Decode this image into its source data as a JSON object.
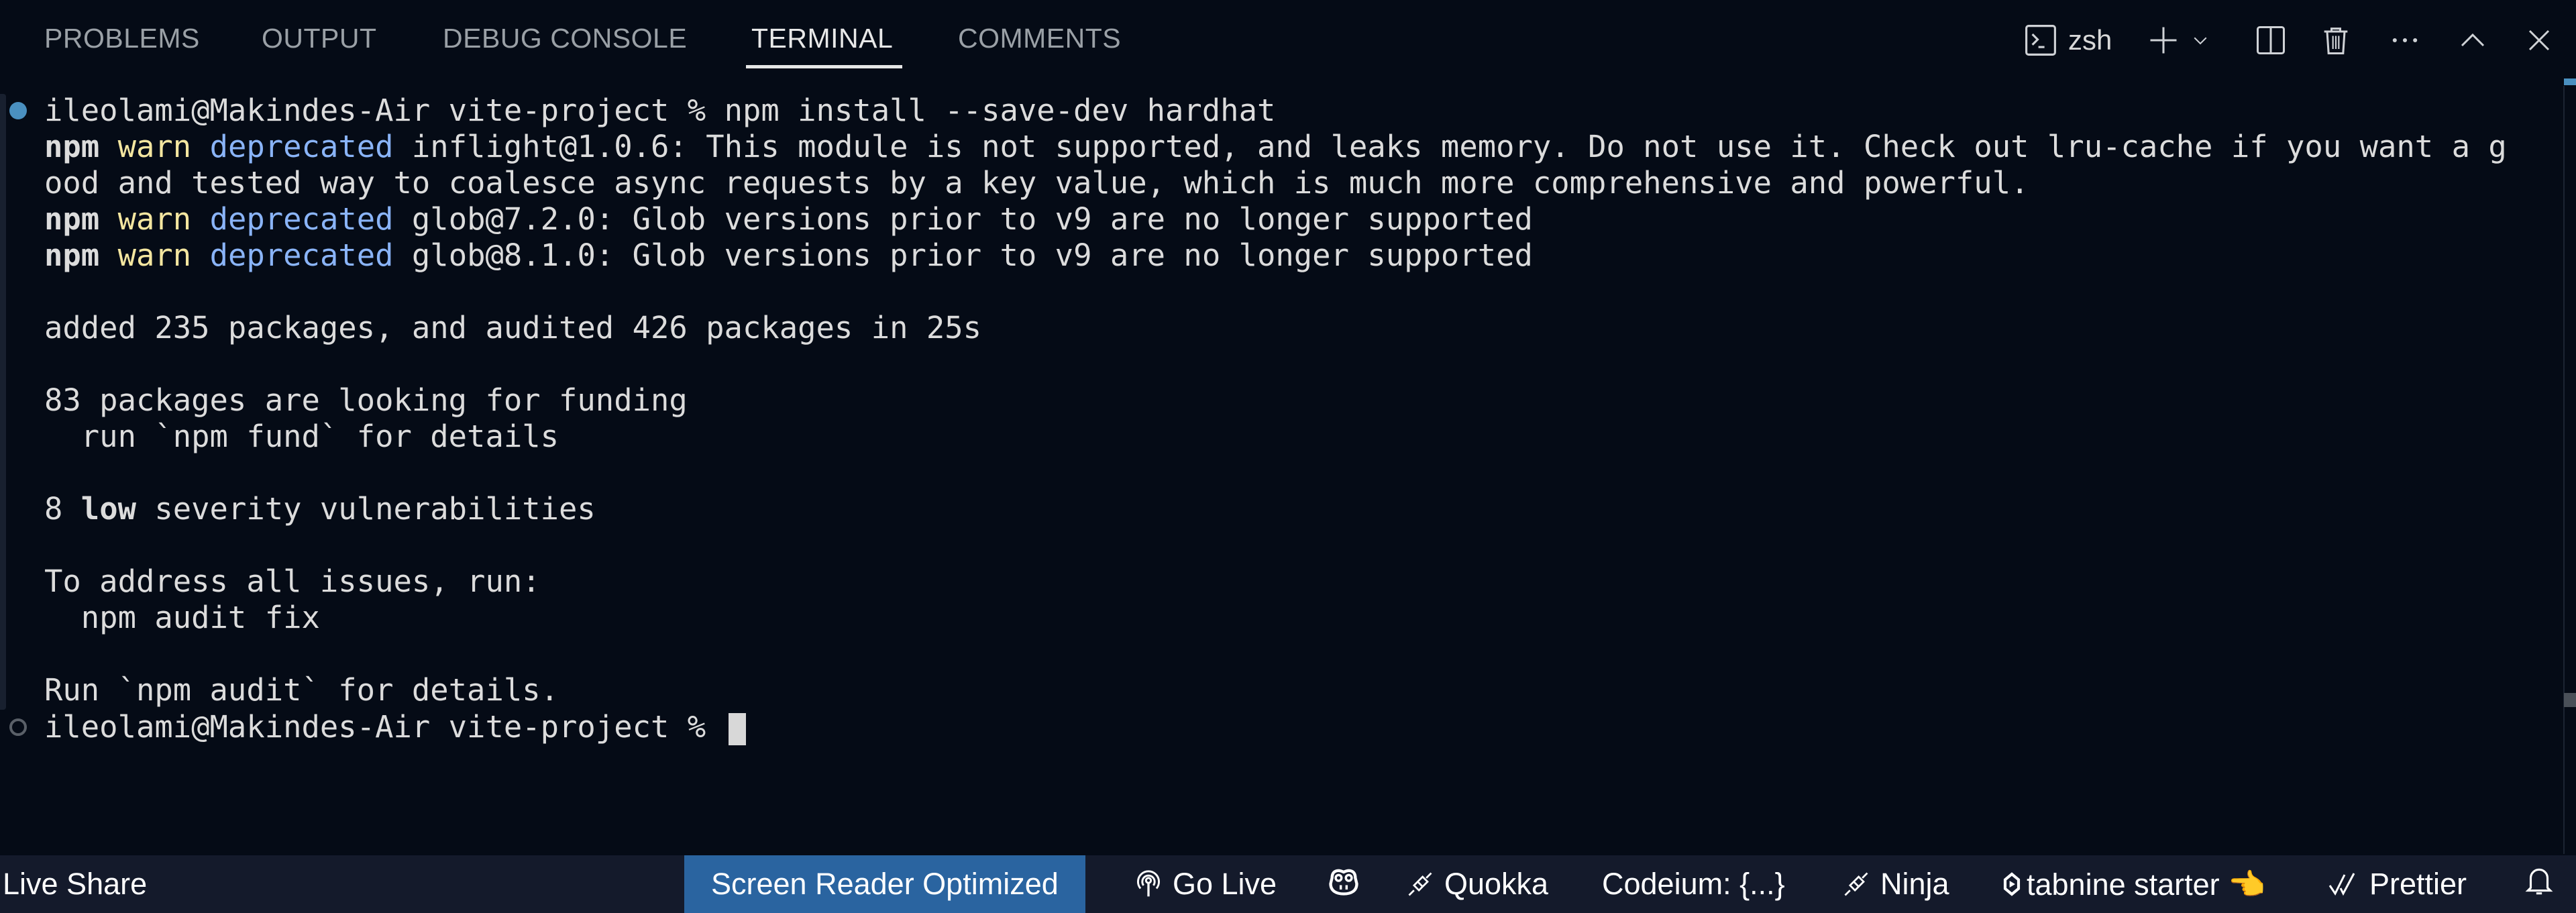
{
  "panel": {
    "tabs": [
      {
        "label": "PROBLEMS",
        "active": false
      },
      {
        "label": "OUTPUT",
        "active": false
      },
      {
        "label": "DEBUG CONSOLE",
        "active": false
      },
      {
        "label": "TERMINAL",
        "active": true
      },
      {
        "label": "COMMENTS",
        "active": false
      }
    ],
    "actions": {
      "shell_label": "zsh",
      "shell_icon": "terminal-icon",
      "new_terminal_icon": "plus-icon",
      "launch_profile_icon": "chevron-down-icon",
      "split_icon": "split-icon",
      "kill_icon": "trash-icon",
      "more_icon": "ellipsis-icon",
      "maximize_icon": "chevron-up-icon",
      "close_icon": "close-icon"
    }
  },
  "terminal": {
    "prompt": "ileolami@Makindes-Air vite-project % ",
    "command": "npm install --save-dev hardhat",
    "warnings": [
      {
        "npm": "npm",
        "level": "warn",
        "tag": "deprecated",
        "text": " inflight@1.0.6: This module is not supported, and leaks memory. Do not use it. Check out lru-cache if you want a g"
      },
      {
        "npm": "npm",
        "level": "warn",
        "tag": "deprecated",
        "text": " glob@7.2.0: Glob versions prior to v9 are no longer supported"
      },
      {
        "npm": "npm",
        "level": "warn",
        "tag": "deprecated",
        "text": " glob@8.1.0: Glob versions prior to v9 are no longer supported"
      }
    ],
    "wrap_line": "ood and tested way to coalesce async requests by a key value, which is much more comprehensive and powerful.",
    "added_line": "added 235 packages, and audited 426 packages in 25s",
    "funding_line": "83 packages are looking for funding",
    "funding_hint": "  run `npm fund` for details",
    "vuln_count": "8 ",
    "vuln_severity": "low",
    "vuln_rest": " severity vulnerabilities",
    "address_line": "To address all issues, run:",
    "fix_cmd": "  npm audit fix",
    "details_line": "Run `npm audit` for details.",
    "final_prompt": "ileolami@Makindes-Air vite-project % ",
    "colors": {
      "success_deco": "#4a90c0",
      "warn": "#f4e6a0",
      "deprecated": "#8ab4f8"
    }
  },
  "statusbar": {
    "items": [
      {
        "label": "Live Share"
      },
      {
        "label": "Screen Reader Optimized"
      },
      {
        "label": "Go Live",
        "icon": "broadcast-icon"
      },
      {
        "label": "",
        "icon": "copilot-icon"
      },
      {
        "label": "Quokka",
        "icon": "plug-icon"
      },
      {
        "label": "Codeium: {...}"
      },
      {
        "label": "Ninja",
        "icon": "plug-icon"
      },
      {
        "label": "tabnine starter 👈",
        "icon": "tabnine-icon"
      },
      {
        "label": "Prettier",
        "icon": "double-check-icon"
      },
      {
        "label": "",
        "icon": "bell-icon"
      }
    ],
    "colors": {
      "background": "#141a2b",
      "highlight": "#2a64a0"
    }
  }
}
